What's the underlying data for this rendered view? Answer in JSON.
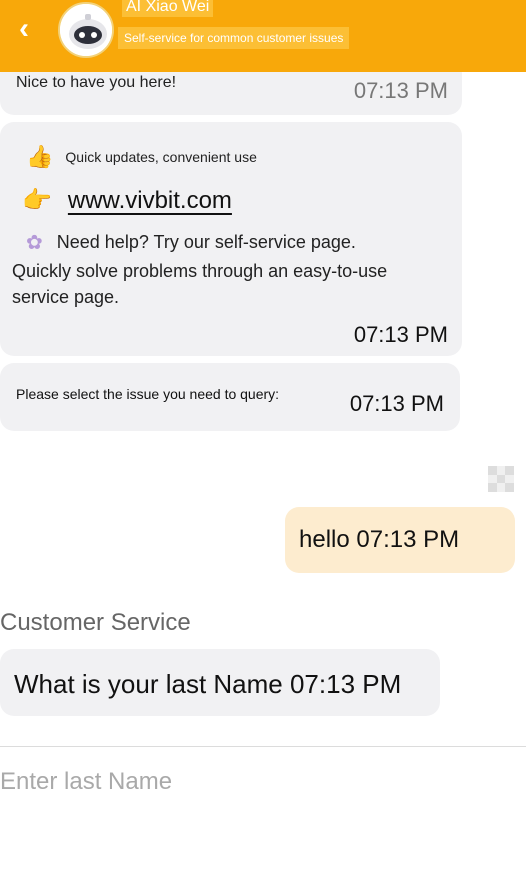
{
  "header": {
    "back_icon": "chevron-left-icon",
    "back_glyph": "‹",
    "avatar_icon": "robot-avatar-icon",
    "agent_name": "AI Xiao Wei",
    "subtitle": "Self-service for common customer issues",
    "background_color": "#f8a80a"
  },
  "messages": {
    "welcome": {
      "text": "Nice to have you here!",
      "time": "07:13 PM"
    },
    "info": {
      "line1_icon": "thumbs-up-icon",
      "line1_glyph": "👍",
      "line1_text": "Quick updates, convenient use",
      "line2_icon": "pointing-hand-icon",
      "line2_glyph": "👉",
      "link_text": "www.vivbit.com",
      "line3_icon": "flower-icon",
      "line3_glyph": "✿",
      "line3_text": "Need help? Try our self-service page.",
      "paragraph": "Quickly solve problems through an easy-to-use service page.",
      "time": "07:13 PM"
    },
    "select": {
      "text": "Please select the issue you need to query:",
      "time": "07:13 PM"
    },
    "user_reply": {
      "text": "hello 07:13 PM",
      "bubble_color": "#fdeccf"
    },
    "section_label": "Customer Service",
    "question": {
      "text": "What is your last Name 07:13 PM"
    }
  },
  "input": {
    "placeholder": "Enter last Name",
    "value": ""
  },
  "colors": {
    "accent": "#f8a80a",
    "bot_bubble": "#f1f1f3"
  }
}
